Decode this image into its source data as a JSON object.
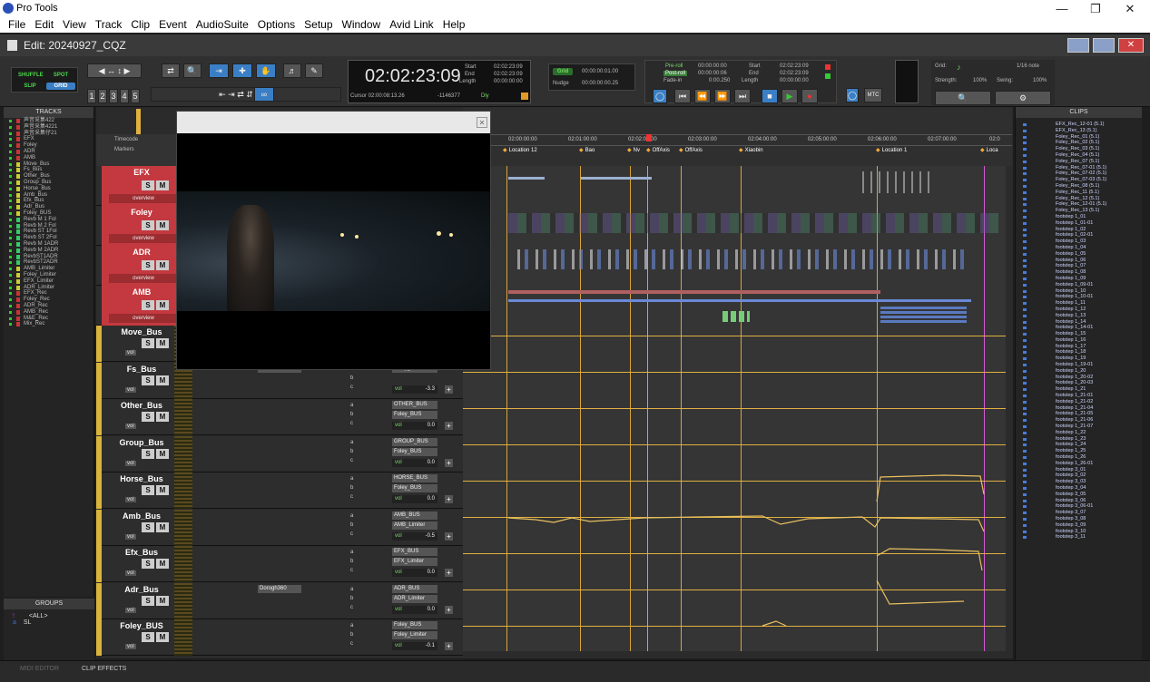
{
  "app": {
    "title": "Pro Tools",
    "logo_icon": "pro-tools-logo"
  },
  "menu": [
    "File",
    "Edit",
    "View",
    "Track",
    "Clip",
    "Event",
    "AudioSuite",
    "Options",
    "Setup",
    "Window",
    "Avid Link",
    "Help"
  ],
  "edit_window": {
    "title": "Edit: 20240927_CQZ"
  },
  "toolbar": {
    "modes": [
      "SHUFFLE",
      "SPOT",
      "SLIP",
      "GRID"
    ],
    "zoom_presets": [
      "1",
      "2",
      "3",
      "4",
      "5"
    ],
    "counter": {
      "main": "02:02:23:09",
      "start_label": "Start",
      "end_label": "End",
      "length_label": "Length",
      "start": "02:02:23:09",
      "end": "02:02:23:09",
      "length": "00:00:00:00"
    },
    "cursor": "Cursor 02:00:08:13.26",
    "cursor_extra": "-1146377",
    "dly_label": "Dly",
    "grid_label": "Grid",
    "grid_value": "00:00:00:01.00",
    "nudge_label": "Nudge",
    "nudge_value": "00:00:00:00.25",
    "preroll_label": "Pre-roll",
    "postroll_label": "Post-roll",
    "fadein_label": "Fade-in",
    "preroll": "00:00:00:00",
    "postroll": "00:00:00:06",
    "fadein": "0:00.250",
    "trans_start_label": "Start",
    "trans_end_label": "End",
    "trans_length_label": "Length",
    "trans_start": "02:02:23:09",
    "trans_end": "02:02:23:09",
    "trans_length": "00:00:00:00",
    "mtc_label": "MTC",
    "grid2_label": "Grid:",
    "grid2_value": "1/16 note",
    "strength_label": "Strength:",
    "strength_value": "100%",
    "swing_label": "Swing:",
    "swing_value": "100%"
  },
  "tracks_panel": {
    "title": "TRACKS",
    "items": [
      "声音采集422",
      "声音采集4221",
      "声音采集仔21",
      "EFX",
      "Foley",
      "ADR",
      "AMB",
      "Move_Bus",
      "Fs_Bus",
      "Other_Bus",
      "Group_Bus",
      "Horse_Bus",
      "Amb_Bus",
      "Efx_Bus",
      "Adr_Bus",
      "Foley_BUS",
      "Revb M 1 Fol",
      "Revb M 2 Fol",
      "Revb ST 1Fol",
      "Revb ST 2Fol",
      "Revb M 1ADR",
      "Revb M 2ADR",
      "RevbST1ADR",
      "RevbST2ADR",
      "AMB_Limiter",
      "Foley_Limiter",
      "EFX_Limiter",
      "ADR_Limiter",
      "EFX_Rec",
      "Foley_Rec",
      "ADR_Rec",
      "AMB_Rec",
      "M&E_Rec",
      "Mix_Rec"
    ]
  },
  "groups_panel": {
    "title": "GROUPS",
    "items": [
      "<ALL>",
      "SL"
    ],
    "item_letters": [
      "!",
      "a"
    ]
  },
  "edit_rows": {
    "timecode_label": "Timecode",
    "markers_label": "Markers"
  },
  "ruler": {
    "ticks": [
      "02:00:00:00",
      "02:01:00:00",
      "02:02:00:00",
      "02:03:00:00",
      "02:04:00:00",
      "02:05:00:00",
      "02:06:00:00",
      "02:07:00:00",
      "02:0"
    ],
    "markers": [
      "Location 12",
      "Bao",
      "Nv",
      "OffAxis",
      "OffAxis",
      "Xiaobin",
      "Location 1",
      "Loca"
    ]
  },
  "folder_tracks": [
    {
      "name": "EFX",
      "overview": "overview"
    },
    {
      "name": "Foley",
      "overview": "overview"
    },
    {
      "name": "ADR",
      "overview": "overview"
    },
    {
      "name": "AMB",
      "overview": "overview"
    }
  ],
  "aux_tracks": [
    {
      "name": "Move_Bus",
      "out": "",
      "vol": ""
    },
    {
      "name": "Fs_Bus",
      "insert": "D3 ComLim",
      "out": "Foley_BUS",
      "vol": "-3.3"
    },
    {
      "name": "Other_Bus",
      "out": "OTHER_BUS",
      "out2": "Foley_BUS",
      "vol": "0.0"
    },
    {
      "name": "Group_Bus",
      "out": "GROUP_BUS",
      "out2": "Foley_BUS",
      "vol": "0.0"
    },
    {
      "name": "Horse_Bus",
      "out": "HORSE_BUS",
      "out2": "Foley_BUS",
      "vol": "0.0"
    },
    {
      "name": "Amb_Bus",
      "out": "AMB_BUS",
      "out2": "AMB_Limiter",
      "vol": "-0.5"
    },
    {
      "name": "Efx_Bus",
      "out": "EFX_BUS",
      "out2": "EFX_Limiter",
      "vol": "0.0"
    },
    {
      "name": "Adr_Bus",
      "insert": "Dorogh360",
      "out": "ADR_BUS",
      "out2": "ADR_Limiter",
      "vol": "0.0"
    },
    {
      "name": "Foley_BUS",
      "out": "Foley_BUS",
      "out2": "Foley_Limiter",
      "vol": "-0.1"
    }
  ],
  "track_labels": {
    "solo": "S",
    "mute": "M",
    "vol_label": "vol",
    "sends": [
      "a",
      "b",
      "c"
    ]
  },
  "clips_panel": {
    "title": "CLIPS",
    "items": [
      "EFX_Rec_12-01 (5.1)",
      "EFX_Rec_13 (5.1)",
      "Foley_Rec_01 (5.1)",
      "Foley_Rec_02 (5.1)",
      "Foley_Rec_03 (5.1)",
      "Foley_Rec_04 (5.1)",
      "Foley_Rec_07 (5.1)",
      "Foley_Rec_07-01 (5.1)",
      "Foley_Rec_07-02 (5.1)",
      "Foley_Rec_07-03 (5.1)",
      "Foley_Rec_08 (5.1)",
      "Foley_Rec_11 (5.1)",
      "Foley_Rec_12 (5.1)",
      "Foley_Rec_12-01 (5.1)",
      "Foley_Rec_13 (5.1)",
      "footstep 1_01",
      "footstep 1_01-01",
      "footstep 1_02",
      "footstep 1_02-01",
      "footstep 1_03",
      "footstep 1_04",
      "footstep 1_05",
      "footstep 1_06",
      "footstep 1_07",
      "footstep 1_08",
      "footstep 1_09",
      "footstep 1_09-01",
      "footstep 1_10",
      "footstep 1_10-01",
      "footstep 1_11",
      "footstep 1_12",
      "footstep 1_13",
      "footstep 1_14",
      "footstep 1_14-01",
      "footstep 1_15",
      "footstep 1_16",
      "footstep 1_17",
      "footstep 1_18",
      "footstep 1_19",
      "footstep 1_19-01",
      "footstep 1_20",
      "footstep 1_20-02",
      "footstep 1_20-03",
      "footstep 1_21",
      "footstep 1_21-01",
      "footstep 1_21-02",
      "footstep 1_21-04",
      "footstep 1_21-05",
      "footstep 1_21-06",
      "footstep 1_21-07",
      "footstep 1_22",
      "footstep 1_23",
      "footstep 1_24",
      "footstep 1_25",
      "footstep 1_26",
      "footstep 1_26-01",
      "footstep 3_01",
      "footstep 3_02",
      "footstep 3_03",
      "footstep 3_04",
      "footstep 3_05",
      "footstep 3_06",
      "footstep 3_06-01",
      "footstep 3_07",
      "footstep 3_08",
      "footstep 3_09",
      "footstep 3_10",
      "footstep 3_11"
    ]
  },
  "bottom": {
    "midi_editor": "MIDI EDITOR",
    "clip_effects": "CLIP EFFECTS"
  },
  "colors": {
    "accent": "#3a7fc5",
    "folder_red": "#c4393f",
    "lane_yellow": "#e0b040",
    "clip_blue": "#4a7bd8"
  }
}
